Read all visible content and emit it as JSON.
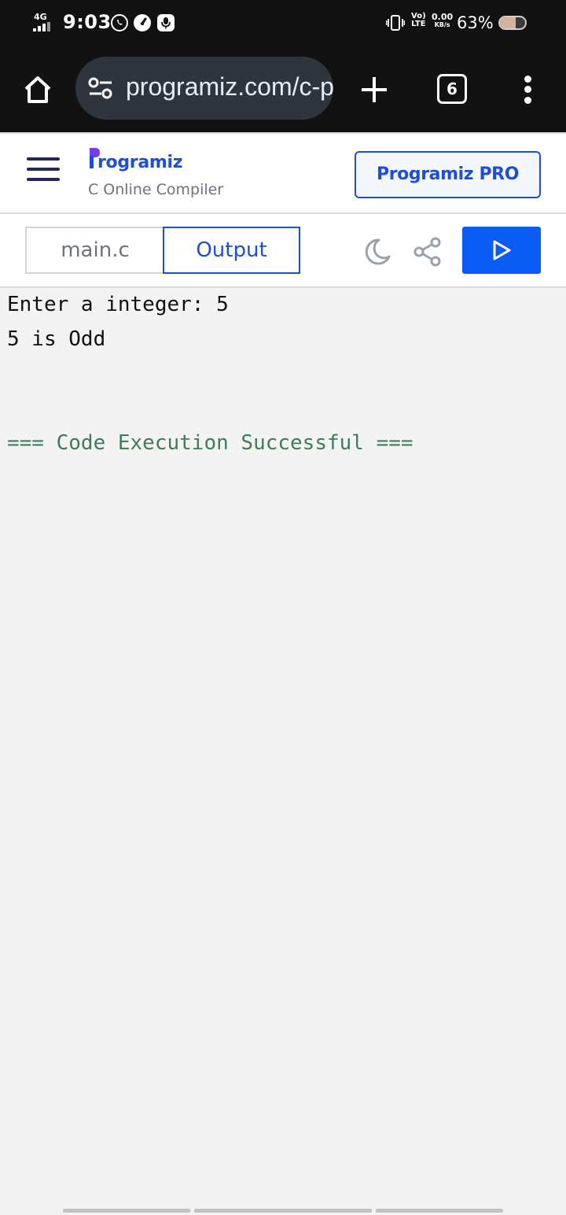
{
  "status_bar": {
    "network": "4G",
    "time": "9:03",
    "volte": "Vo)",
    "lte": "LTE",
    "data_speed": "0.00",
    "data_unit": "KB/s",
    "battery_percent": "63%",
    "battery_level": 0.63,
    "notification_icons": [
      "whatsapp-icon",
      "speedometer-icon",
      "voice-recorder-icon"
    ]
  },
  "browser": {
    "url": "programiz.com/c-programming/online-compiler",
    "tab_count": "6",
    "icons": [
      "home-icon",
      "site-settings-icon",
      "plus-icon",
      "tab-switcher-icon",
      "more-vert-icon"
    ]
  },
  "site_header": {
    "logo_text": "rogramiz",
    "logo_initial": "P",
    "subtitle": "C Online Compiler",
    "pro_button": "Programiz PRO",
    "colors": {
      "brand_blue": "#1d4ed8",
      "logo_purple": "#7c3aed",
      "run_blue": "#0b5cf5"
    }
  },
  "toolbar": {
    "file_tab": "main.c",
    "output_tab": "Output",
    "active_tab": "Output",
    "icons": [
      "moon-icon",
      "share-icon",
      "play-icon"
    ]
  },
  "output": {
    "line1": "Enter a integer: 5",
    "line2": "5 is Odd",
    "status": "=== Code Execution Successful ===",
    "status_color": "#3f7c5a"
  }
}
